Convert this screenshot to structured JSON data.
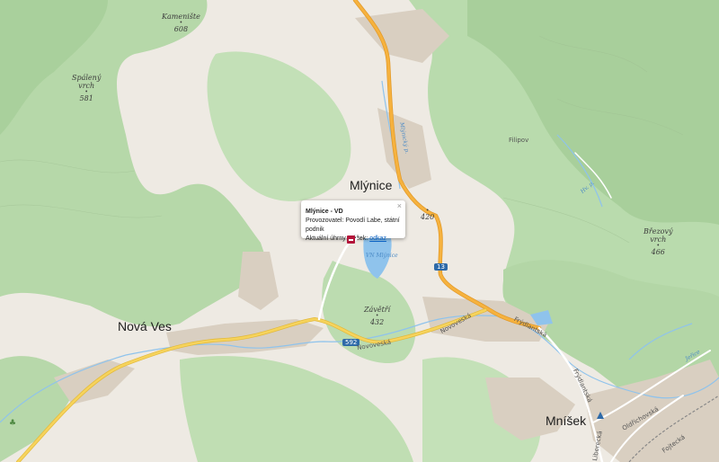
{
  "map": {
    "towns": {
      "mlynice": "Mlýnice",
      "nova_ves": "Nová Ves",
      "mnisek": "Mníšek",
      "filipov": "Filipov"
    },
    "peaks": {
      "kameniste": {
        "name": "Kamenište",
        "elev": "608"
      },
      "spaleny": {
        "name_line1": "Spálený",
        "name_line2": "vrch",
        "elev": "581"
      },
      "p420": {
        "elev": "420"
      },
      "zavetri": {
        "name": "Závětří",
        "elev": "432"
      },
      "brezovy": {
        "name_line1": "Březový",
        "name_line2": "vrch",
        "elev": "466"
      }
    },
    "roads": {
      "route_13": "13",
      "route_592": "592",
      "novoveska_1": "Novoveská",
      "novoveska_2": "Novoveská",
      "frydlantska_1": "Frýdlantská",
      "frydlantska_2": "Frýdlantská",
      "liberecka": "Liberecká",
      "oldrichovska": "Oldřichovská",
      "fojtecka": "Fojtecká"
    },
    "water": {
      "vodni_nadrz": "VN Mlýnice",
      "stream_1": "Mlýnický p.",
      "stream_2": "Hv. p.",
      "stream_3": "Jeřice"
    }
  },
  "popup": {
    "title": "Mlýnice - VD",
    "operator": "Provozovatel: Povodí Labe, státní podnik",
    "rain_prefix": "Aktuální úhrny srážek:",
    "rain_link": "odkaz",
    "close": "×"
  },
  "colors": {
    "forest": "#b8d9ab",
    "forest_dark": "#a8cf9b",
    "meadow": "#eeeae3",
    "road_major": "#f6b23e",
    "road_secondary": "#f6d35c",
    "water": "#8fc3ec",
    "built": "#d7ccbd",
    "marker": "#b3153a"
  }
}
